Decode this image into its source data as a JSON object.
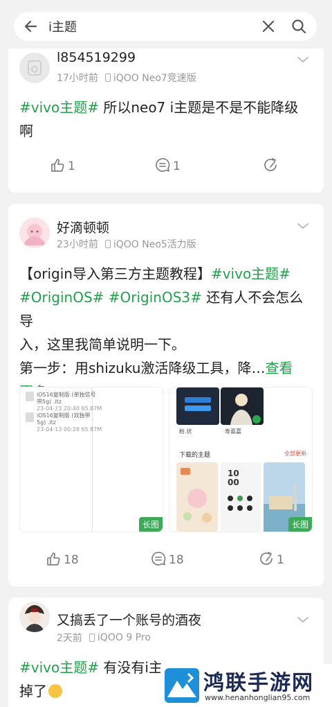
{
  "search": {
    "query": "i主题",
    "back_icon": "arrow-left-icon",
    "clear_icon": "close-icon",
    "search_icon": "search-icon"
  },
  "posts": [
    {
      "username": "l854519299",
      "time": "17小时前",
      "device": "iQOO Neo7竞速版",
      "tag1": "#vivo主题#",
      "text1": " 所以neo7 i主题是不是不能降级",
      "text2": "啊",
      "likes": "1",
      "comments": "1"
    },
    {
      "username": "好滴顿顿",
      "time": "23小时前",
      "device": "iQOO Neo5活力版",
      "line1_pre": "【origin导入第三方主题教程】",
      "line1_tag": "#vivo主题#",
      "line2_tag1": "#OriginOS#",
      "line2_tag2": "#OriginOS3#",
      "line2_post": " 还有人不会怎么导",
      "line3": "入，这里我简单说明一下。",
      "line4_pre": "第一步：用shizuku激活降级工具，降…",
      "line4_more": "查看",
      "line5_more": "更多",
      "image_badge": "长图",
      "likes": "18",
      "comments": "18",
      "shares": "1",
      "img1": {
        "file1_name": "iOS16复制版 (单独信号",
        "file1_name2": "带5g) .itz",
        "file1_date": "23-04-23 20:40 65.87M",
        "file2_name": "iOS16复制版 (双独带",
        "file2_name2": "5g) .itz",
        "file2_date": "23-04-13 00:28 65.87M"
      },
      "img2": {
        "caption_left": "粉.状",
        "caption_right": "寿喜嘉",
        "section_title": "下载的主题",
        "update_all": "全部更新",
        "clock_top": "10",
        "clock_bottom": "00"
      }
    },
    {
      "username": "又搞丢了一个账号的酒夜",
      "time": "2天前",
      "device": "iQOO 9 Pro",
      "tag1": "#vivo主题#",
      "text1": " 有没有i主",
      "text2": "掉了"
    }
  ],
  "watermark": {
    "title": "鸿联手游网",
    "url": "www.henanhonglian95.com"
  },
  "colors": {
    "tag": "#1fa24a",
    "background": "#f2f2f2",
    "card": "#ffffff"
  }
}
